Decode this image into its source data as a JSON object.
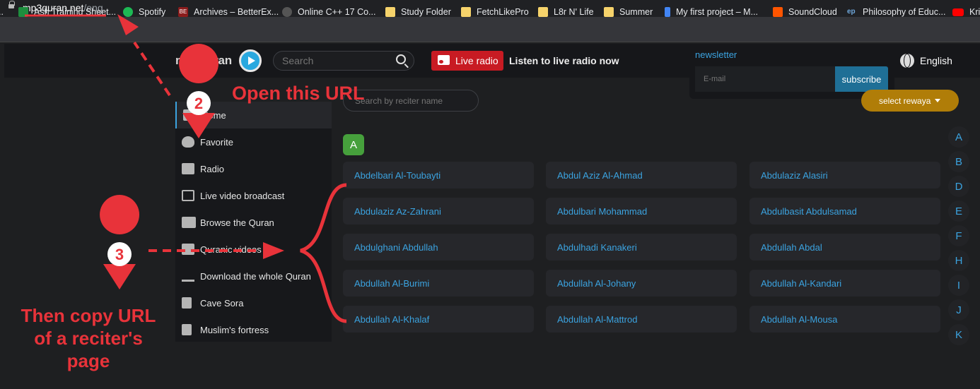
{
  "browser": {
    "url_host": "mp3quran.net",
    "url_path": "/eng",
    "bookmarks": [
      {
        "label": "Ash Training Sheet...",
        "color": "#1e8e3e"
      },
      {
        "label": "Spotify",
        "color": "#1db954"
      },
      {
        "label": "Archives – BetterEx...",
        "color": "#8b1c1c",
        "glyph": "BE"
      },
      {
        "label": "Online C++ 17 Co...",
        "color": "#2b2b2b"
      },
      {
        "label": "Study Folder",
        "color": "#f6d36b"
      },
      {
        "label": "FetchLikePro",
        "color": "#f6d36b"
      },
      {
        "label": "L8r N' Life",
        "color": "#f6d36b"
      },
      {
        "label": "Summer",
        "color": "#f6d36b"
      },
      {
        "label": "My first project – M...",
        "color": "#4285f4"
      },
      {
        "label": "SoundCloud",
        "color": "#ff5500"
      },
      {
        "label": "Philosophy of Educ...",
        "color": "#6fa8dc",
        "glyph": "ep"
      },
      {
        "label": "Kri",
        "color": "#ff0000"
      }
    ]
  },
  "header": {
    "logo_text_a": "mp3",
    "logo_text_b": "quran",
    "logo_mark": "™",
    "search_placeholder": "Search",
    "live_radio_label": "Live radio",
    "live_radio_text": "Listen to live radio now",
    "language": "English"
  },
  "newsletter": {
    "title": "newsletter",
    "email_placeholder": "E-mail",
    "subscribe_label": "subscribe"
  },
  "sidebar": {
    "items": [
      {
        "label": "Home",
        "icon": "home-icon"
      },
      {
        "label": "Favorite",
        "icon": "heart-icon"
      },
      {
        "label": "Radio",
        "icon": "radio-icon"
      },
      {
        "label": "Live video broadcast",
        "icon": "tv-icon"
      },
      {
        "label": "Browse the Quran",
        "icon": "book-icon"
      },
      {
        "label": "Quranic videos",
        "icon": "video-icon"
      },
      {
        "label": "Download the whole Quran",
        "icon": "download-icon"
      },
      {
        "label": "Cave Sora",
        "icon": "cave-book-icon"
      },
      {
        "label": "Muslim's fortress",
        "icon": "fortress-book-icon"
      }
    ]
  },
  "main": {
    "reciter_search_placeholder": "Search by reciter name",
    "rewaya_label": "select rewaya",
    "current_letter": "A",
    "reciters": [
      "Abdelbari Al-Toubayti",
      "Abdul Aziz Al-Ahmad",
      "Abdulaziz Alasiri",
      "Abdulaziz Az-Zahrani",
      "Abdulbari Mohammad",
      "Abdulbasit Abdulsamad",
      "Abdulghani Abdullah",
      "Abdulhadi Kanakeri",
      "Abdullah Abdal",
      "Abdullah Al-Burimi",
      "Abdullah Al-Johany",
      "Abdullah Al-Kandari",
      "Abdullah Al-Khalaf",
      "Abdullah Al-Mattrod",
      "Abdullah Al-Mousa"
    ],
    "alphabet": [
      "A",
      "B",
      "D",
      "E",
      "F",
      "H",
      "I",
      "J",
      "K"
    ]
  },
  "annotations": {
    "step2_number": "2",
    "step2_text": "Open this URL",
    "step3_number": "3",
    "step3_line1": "Then copy URL",
    "step3_line2": "of a reciter's",
    "step3_line3": "page"
  }
}
